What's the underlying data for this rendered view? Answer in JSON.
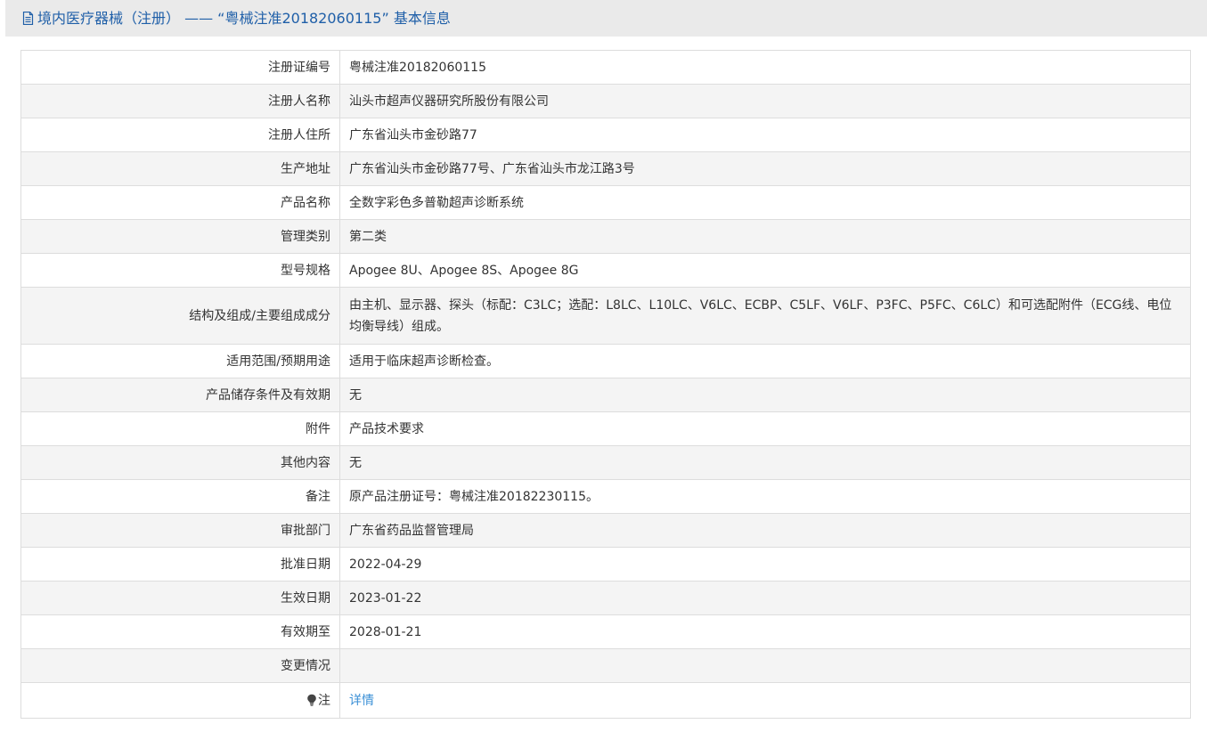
{
  "header": {
    "title": "境内医疗器械（注册） —— “粤械注准20182060115” 基本信息",
    "icon": "document-icon"
  },
  "rows": [
    {
      "label": "注册证编号",
      "value": "粤械注准20182060115"
    },
    {
      "label": "注册人名称",
      "value": "汕头市超声仪器研究所股份有限公司"
    },
    {
      "label": "注册人住所",
      "value": "广东省汕头市金砂路77"
    },
    {
      "label": "生产地址",
      "value": "广东省汕头市金砂路77号、广东省汕头市龙江路3号"
    },
    {
      "label": "产品名称",
      "value": "全数字彩色多普勒超声诊断系统"
    },
    {
      "label": "管理类别",
      "value": "第二类"
    },
    {
      "label": "型号规格",
      "value": "Apogee 8U、Apogee 8S、Apogee 8G"
    },
    {
      "label": "结构及组成/主要组成成分",
      "value": "由主机、显示器、探头（标配：C3LC；选配：L8LC、L10LC、V6LC、ECBP、C5LF、V6LF、P3FC、P5FC、C6LC）和可选配附件（ECG线、电位均衡导线）组成。"
    },
    {
      "label": "适用范围/预期用途",
      "value": "适用于临床超声诊断检查。"
    },
    {
      "label": "产品储存条件及有效期",
      "value": "无"
    },
    {
      "label": "附件",
      "value": "产品技术要求"
    },
    {
      "label": "其他内容",
      "value": "无"
    },
    {
      "label": "备注",
      "value": "原产品注册证号：粤械注准20182230115。"
    },
    {
      "label": "审批部门",
      "value": "广东省药品监督管理局"
    },
    {
      "label": "批准日期",
      "value": "2022-04-29"
    },
    {
      "label": "生效日期",
      "value": "2023-01-22"
    },
    {
      "label": "有效期至",
      "value": "2028-01-21"
    },
    {
      "label": "变更情况",
      "value": ""
    }
  ],
  "note_row": {
    "label": "注",
    "icon": "lightbulb-icon",
    "link_text": "详情"
  },
  "colors": {
    "title": "#1f5fa8",
    "link": "#3a8fd6",
    "alt_row": "#f4f4f4",
    "border": "#dddddd"
  }
}
